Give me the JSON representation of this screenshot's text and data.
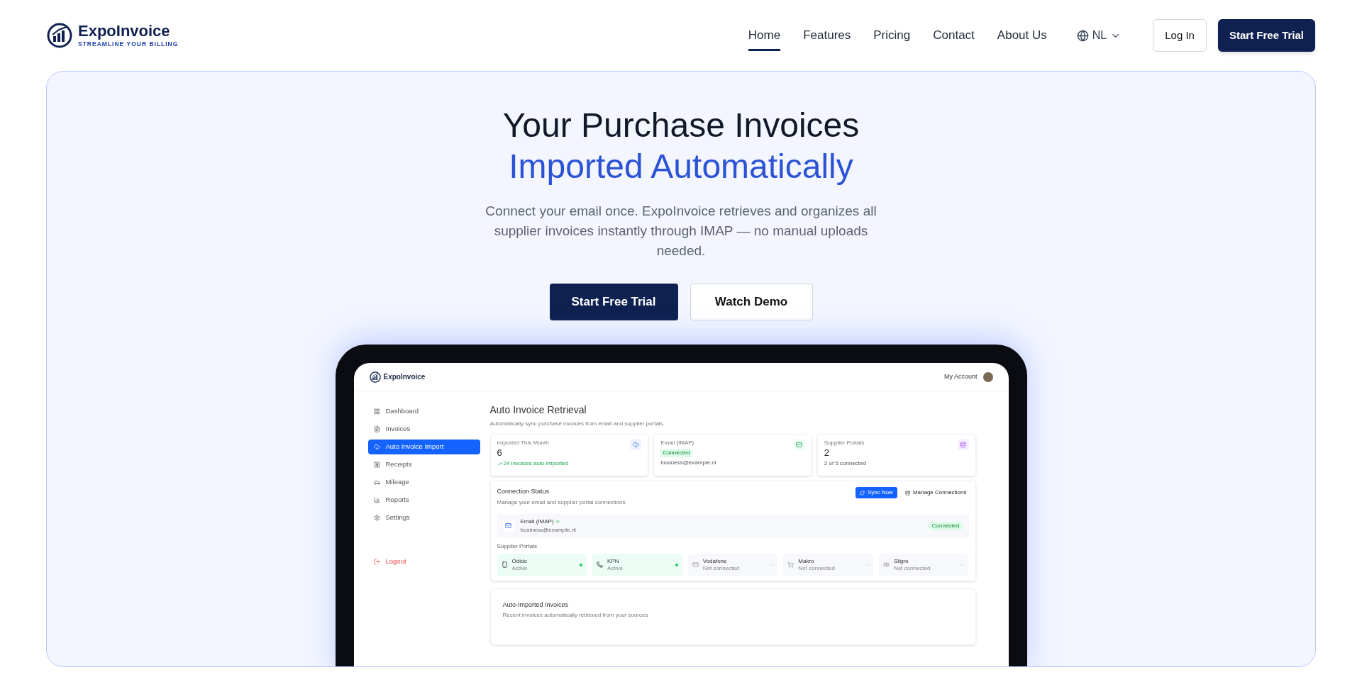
{
  "brand": {
    "name": "ExpoInvoice",
    "tagline": "STREAMLINE YOUR BILLING"
  },
  "nav": [
    {
      "label": "Home",
      "selected": true
    },
    {
      "label": "Features",
      "selected": false
    },
    {
      "label": "Pricing",
      "selected": false
    },
    {
      "label": "Contact",
      "selected": false
    },
    {
      "label": "About Us",
      "selected": false
    }
  ],
  "language": "NL",
  "login": "Log In",
  "trial": "Start Free Trial",
  "hero": {
    "title": "Your Purchase Invoices",
    "highlight": "Imported Automatically",
    "text": "Connect your email once. ExpoInvoice retrieves and organizes all supplier invoices instantly through IMAP — no manual uploads needed.",
    "primary": "Start Free Trial",
    "secondary": "Watch Demo"
  },
  "app": {
    "brand": "ExpoInvoice",
    "account": "My Account",
    "sidebar": [
      {
        "label": "Dashboard",
        "selected": false
      },
      {
        "label": "Invoices",
        "selected": false
      },
      {
        "label": "Auto Invoice Import",
        "selected": true
      },
      {
        "label": "Receipts",
        "selected": false
      },
      {
        "label": "Mileage",
        "selected": false
      },
      {
        "label": "Reports",
        "selected": false
      },
      {
        "label": "Settings",
        "selected": false
      }
    ],
    "logout": "Logout",
    "title": "Auto Invoice Retrieval",
    "subtitle": "Automatically sync purchase invoices from email and supplier portals.",
    "stats": [
      {
        "label": "Imported This Month",
        "value": "6",
        "note": "24 invoices auto-imported",
        "kind": "trend"
      },
      {
        "label": "Email (IMAP)",
        "value": "Connected",
        "note": "business@example.nl",
        "kind": "badge"
      },
      {
        "label": "Supplier Portals",
        "value": "2",
        "note": "2 of 5 connected",
        "kind": "plain"
      }
    ],
    "connection": {
      "title": "Connection Status",
      "subtitle": "Manage your email and supplier portal connections.",
      "sync": "Sync Now",
      "manage": "Manage Connections",
      "email": {
        "name": "Email (IMAP)",
        "address": "business@example.nl",
        "status": "Connected"
      },
      "portals_label": "Supplier Portals",
      "portals": [
        {
          "name": "Odido",
          "status": "Active",
          "connected": true
        },
        {
          "name": "KPN",
          "status": "Active",
          "connected": true
        },
        {
          "name": "Vodafone",
          "status": "Not connected",
          "connected": false
        },
        {
          "name": "Makro",
          "status": "Not connected",
          "connected": false
        },
        {
          "name": "Sligro",
          "status": "Not connected",
          "connected": false
        }
      ]
    },
    "imported": {
      "title": "Auto-Imported Invoices",
      "subtitle": "Recent invoices automatically retrieved from your sources"
    }
  }
}
